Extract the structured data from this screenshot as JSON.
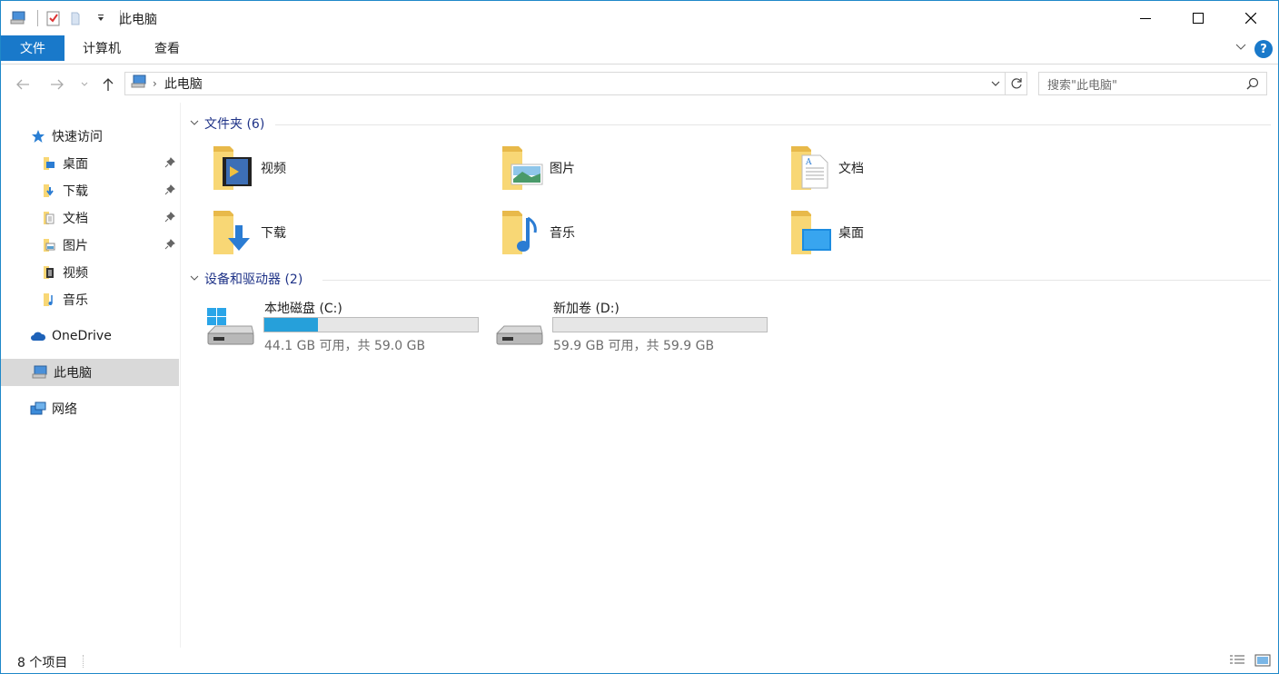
{
  "window": {
    "title": "此电脑",
    "minimize_icon": "minimize-icon",
    "maximize_icon": "maximize-icon",
    "close_icon": "close-icon"
  },
  "ribbon": {
    "tabs": [
      {
        "label": "文件",
        "active": true
      },
      {
        "label": "计算机"
      },
      {
        "label": "查看"
      }
    ],
    "help_label": "?"
  },
  "address": {
    "crumb": "此电脑",
    "search_placeholder": "搜索\"此电脑\""
  },
  "sidebar": {
    "items": [
      {
        "label": "快速访问",
        "icon": "star-icon"
      },
      {
        "label": "桌面",
        "icon": "desktop-folder-icon",
        "pinned": true
      },
      {
        "label": "下载",
        "icon": "downloads-folder-icon",
        "pinned": true
      },
      {
        "label": "文档",
        "icon": "documents-folder-icon",
        "pinned": true
      },
      {
        "label": "图片",
        "icon": "pictures-folder-icon",
        "pinned": true
      },
      {
        "label": "视频",
        "icon": "videos-folder-icon"
      },
      {
        "label": "音乐",
        "icon": "music-folder-icon"
      },
      {
        "label": "OneDrive",
        "icon": "onedrive-cloud-icon"
      },
      {
        "label": "此电脑",
        "icon": "this-pc-icon",
        "selected": true
      },
      {
        "label": "网络",
        "icon": "network-icon"
      }
    ]
  },
  "content": {
    "folders_header": "文件夹 (6)",
    "folders": [
      {
        "label": "视频",
        "icon": "videos-folder-icon"
      },
      {
        "label": "图片",
        "icon": "pictures-folder-icon"
      },
      {
        "label": "文档",
        "icon": "documents-folder-icon"
      },
      {
        "label": "下载",
        "icon": "downloads-folder-icon"
      },
      {
        "label": "音乐",
        "icon": "music-folder-icon"
      },
      {
        "label": "桌面",
        "icon": "desktop-folder-icon"
      }
    ],
    "devices_header": "设备和驱动器 (2)",
    "drives": [
      {
        "name": "本地磁盘 (C:)",
        "free_text": "44.1 GB 可用，共 59.0 GB",
        "used_fraction": 0.253,
        "icon": "system-drive-icon"
      },
      {
        "name": "新加卷 (D:)",
        "free_text": "59.9 GB 可用，共 59.9 GB",
        "used_fraction": 0.0,
        "icon": "drive-icon"
      }
    ]
  },
  "statusbar": {
    "item_count": "8 个项目"
  },
  "colors": {
    "accent": "#1979ca",
    "drive_bar": "#26a0da",
    "group_header": "#1e3287",
    "folder_yellow": "#f8d775"
  }
}
